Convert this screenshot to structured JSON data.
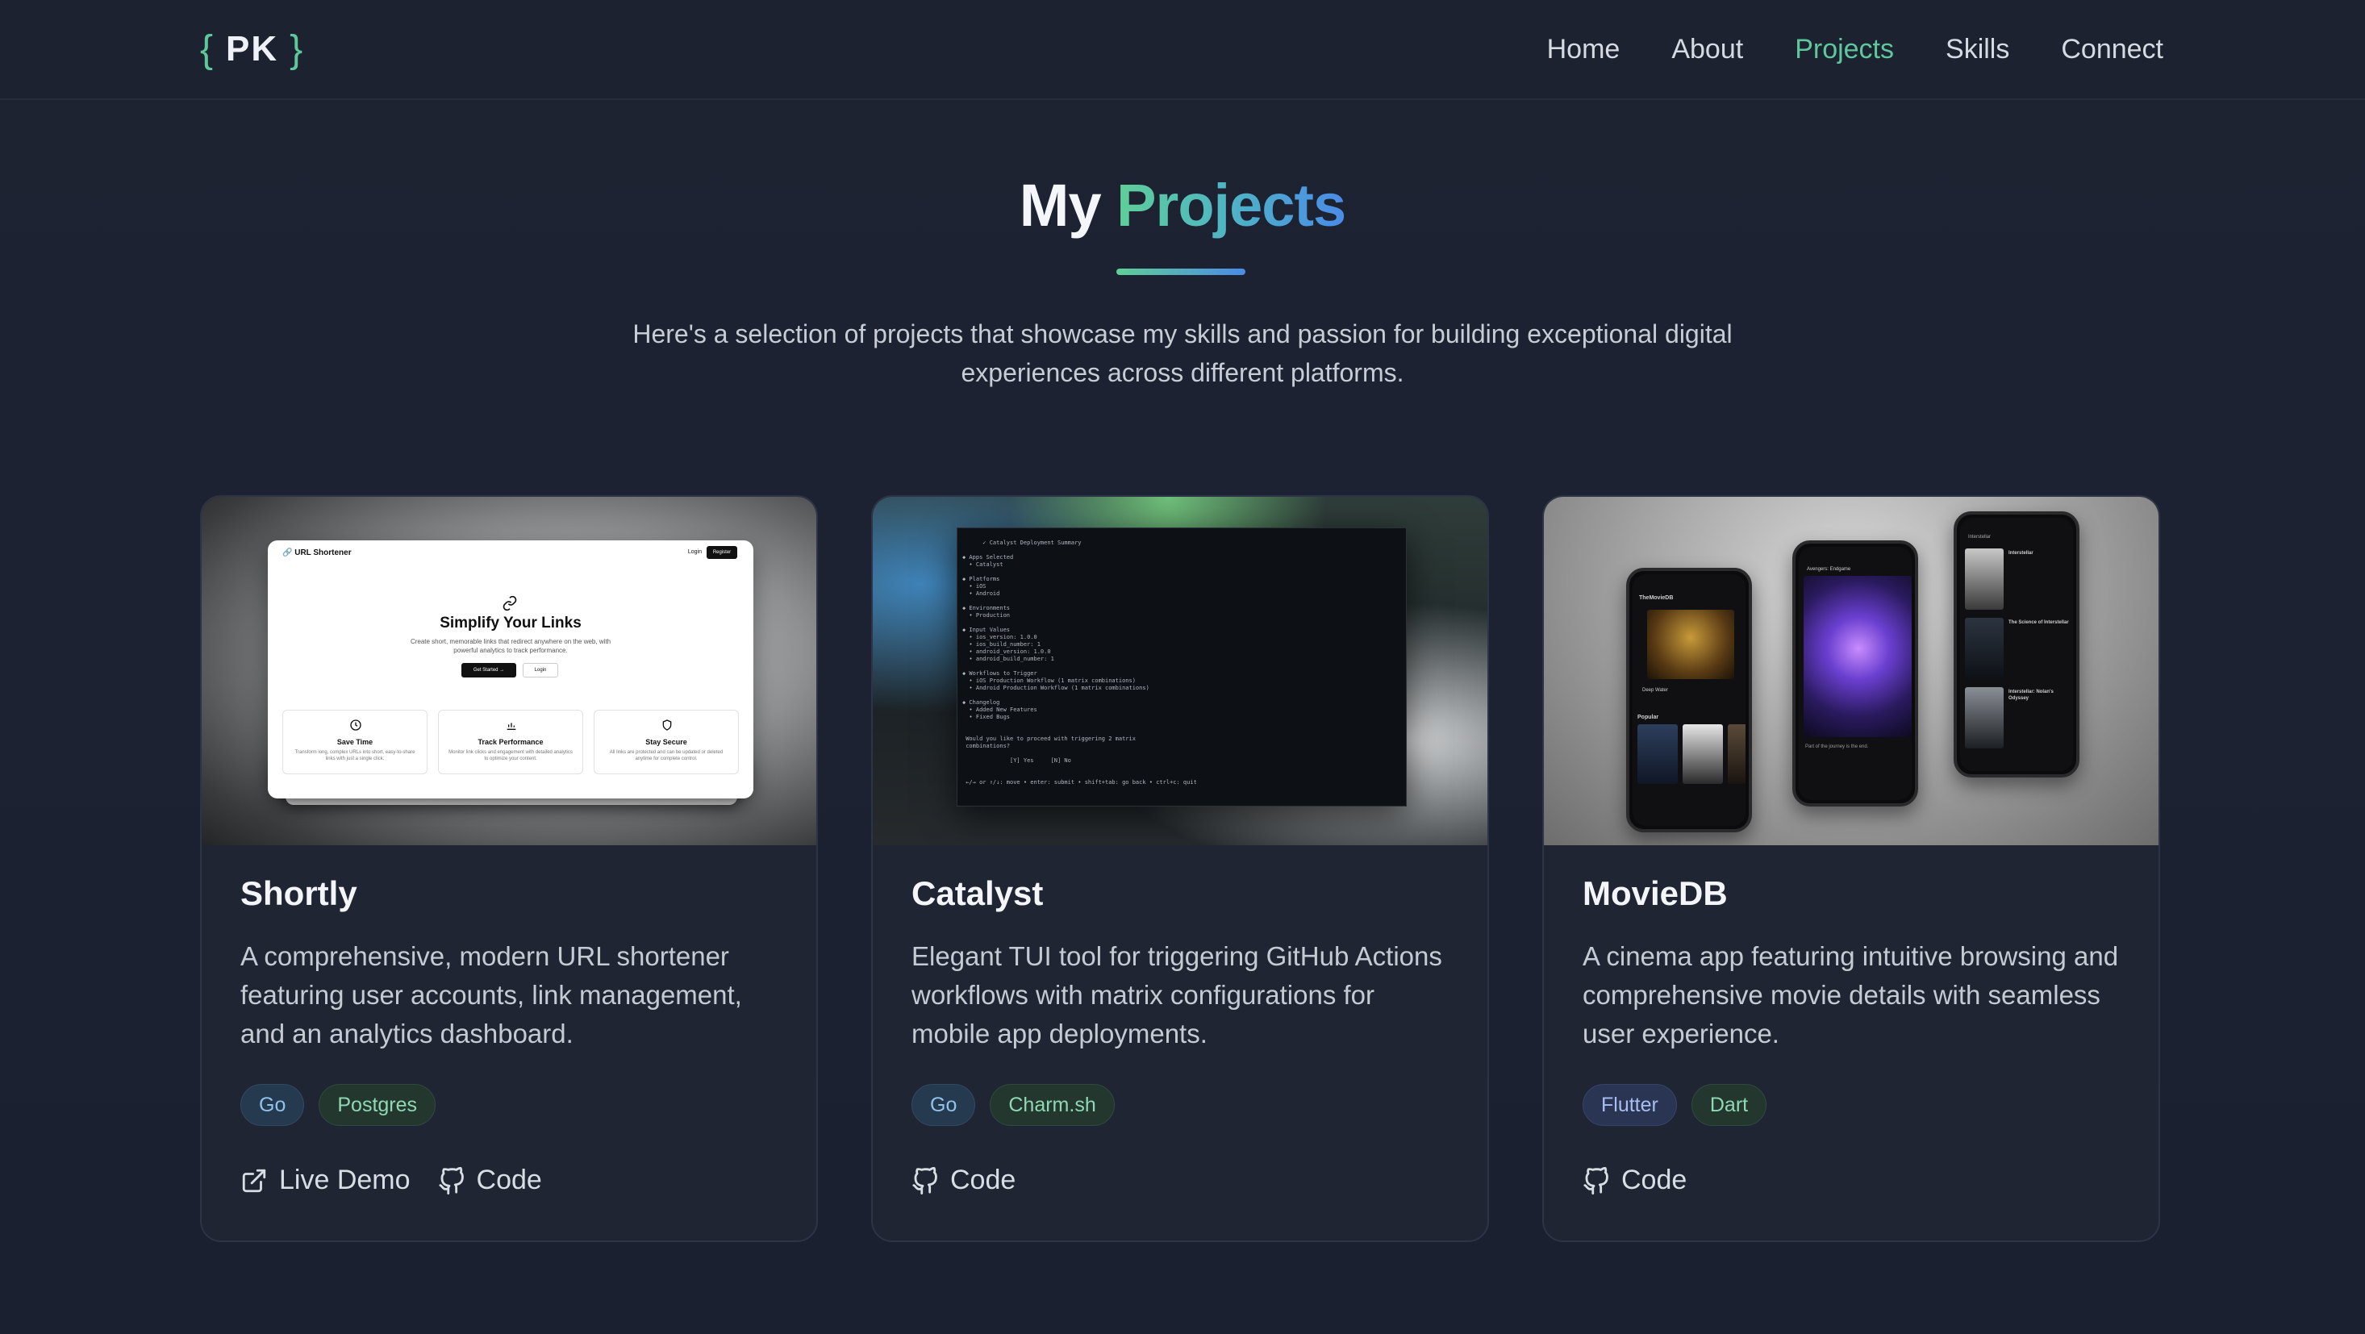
{
  "header": {
    "logo": {
      "open_brace": "{",
      "initials": "PK",
      "close_brace": "}"
    },
    "nav": [
      {
        "label": "Home",
        "active": false
      },
      {
        "label": "About",
        "active": false
      },
      {
        "label": "Projects",
        "active": true
      },
      {
        "label": "Skills",
        "active": false
      },
      {
        "label": "Connect",
        "active": false
      }
    ]
  },
  "hero": {
    "title_part1": "My",
    "title_part2": "Projects",
    "intro": "Here's a selection of projects that showcase my skills and passion for building exceptional digital experiences across different platforms."
  },
  "projects": [
    {
      "title": "Shortly",
      "description": "A comprehensive, modern URL shortener featuring user accounts, link management, and an analytics dashboard.",
      "tags": [
        "Go",
        "Postgres"
      ],
      "links": [
        "Live Demo",
        "Code"
      ],
      "preview": {
        "brand": "URL Shortener",
        "login": "Login",
        "register": "Register",
        "heading": "Simplify Your Links",
        "subheading": "Create short, memorable links that redirect anywhere on the web, with powerful analytics to track performance.",
        "primary_button": "Get Started →",
        "secondary_button": "Login",
        "features": [
          {
            "title": "Save Time",
            "text": "Transform long, complex URLs into short, easy-to-share links with just a single click."
          },
          {
            "title": "Track Performance",
            "text": "Monitor link clicks and engagement with detailed analytics to optimize your content."
          },
          {
            "title": "Stay Secure",
            "text": "All links are protected and can be updated or deleted anytime for complete control."
          }
        ]
      }
    },
    {
      "title": "Catalyst",
      "description": "Elegant TUI tool for triggering GitHub Actions workflows with matrix configurations for mobile app deployments.",
      "tags": [
        "Go",
        "Charm.sh"
      ],
      "links": [
        "Code"
      ],
      "preview": {
        "terminal_text": "      ✓ Catalyst Deployment Summary\n\n◆ Apps Selected\n  • Catalyst\n\n◆ Platforms\n  • iOS\n  • Android\n\n◆ Environments\n  • Production\n\n◆ Input Values\n  • ios_version: 1.0.0\n  • ios_build_number: 1\n  • android_version: 1.0.0\n  • android_build_number: 1\n\n◆ Workflows to Trigger\n  • iOS Production Workflow (1 matrix combinations)\n  • Android Production Workflow (1 matrix combinations)\n\n◆ Changelog\n  • Added New Features\n  • Fixed Bugs\n\n\n Would you like to proceed with triggering 2 matrix\n combinations?\n\n              [Y] Yes     [N] No\n\n\n ←/→ or ↑/↓: move • enter: submit • shift+tab: go back • ctrl+c: quit"
      }
    },
    {
      "title": "MovieDB",
      "description": "A cinema app featuring intuitive browsing and comprehensive movie details with seamless user experience.",
      "tags": [
        "Flutter",
        "Dart"
      ],
      "links": [
        "Code"
      ],
      "preview": {
        "phone1_title": "TheMovieDB",
        "phone1_feature": "Deep Water",
        "phone1_section": "Popular",
        "phone2_title": "Avengers: Endgame",
        "phone3_search": "Interstellar",
        "phone3_results": [
          "Interstellar",
          "The Science of Interstellar",
          "Interstellar: Nolan's Odyssey"
        ]
      }
    }
  ],
  "colors": {
    "accent_green": "#5ec79b",
    "accent_blue": "#4a8be8",
    "background": "#1c2231",
    "card_background": "#1f2533"
  },
  "icons": {
    "live_demo": "external-link-icon",
    "code": "github-icon"
  }
}
